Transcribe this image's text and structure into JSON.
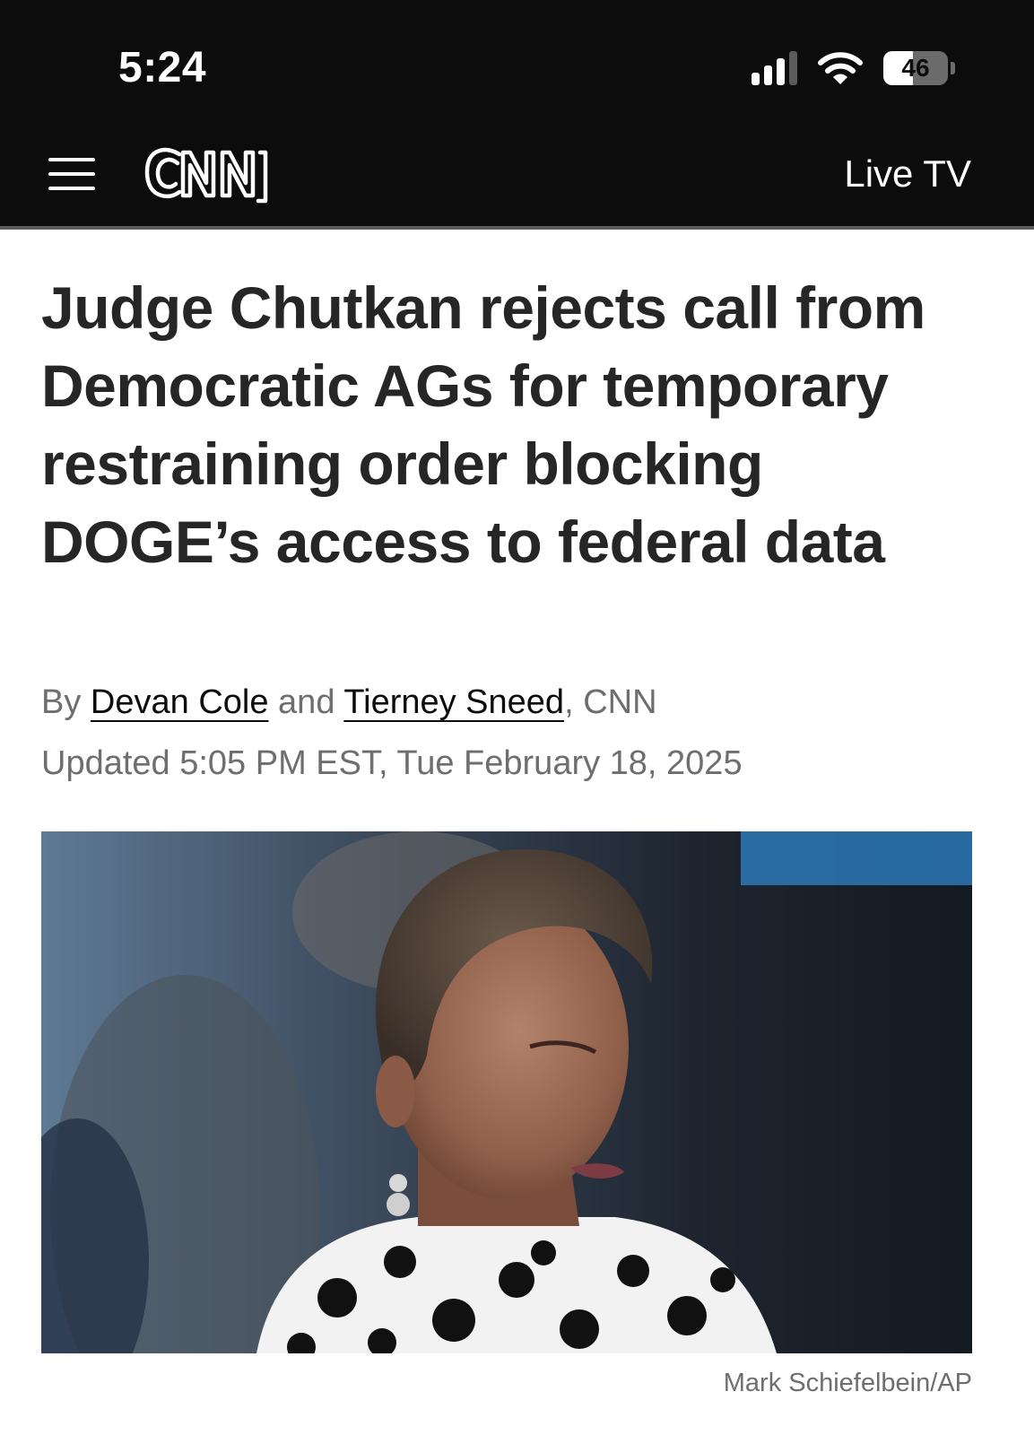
{
  "status_bar": {
    "time": "5:24",
    "battery_level": "46",
    "battery_percent": 46,
    "signal_bars_active": 3,
    "signal_bars_total": 4,
    "icons": [
      "signal-icon",
      "wifi-icon",
      "battery-icon"
    ]
  },
  "nav": {
    "menu_icon": "hamburger-menu-icon",
    "logo": "CNN",
    "live_tv_label": "Live TV"
  },
  "article": {
    "headline": "Judge Chutkan rejects call from Democratic AGs for temporary restraining order blocking DOGE’s access to federal data",
    "byline_prefix": "By",
    "author_1": "Devan Cole",
    "byline_and": "and",
    "author_2": "Tierney Sneed",
    "byline_source": ", CNN",
    "updated": "Updated 5:05 PM EST, Tue February 18, 2025",
    "photo_credit": "Mark Schiefelbein/AP"
  },
  "colors": {
    "header_bg": "#0c0c0c",
    "headline_text": "#262626",
    "meta_text": "#6e6e6e"
  }
}
